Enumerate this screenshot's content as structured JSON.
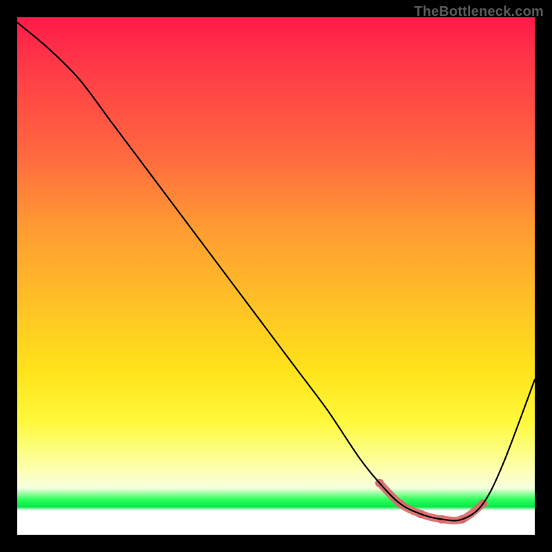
{
  "watermark": "TheBottleneck.com",
  "colors": {
    "accent": "#d96a6a",
    "curve": "#000000",
    "background": "#000000"
  },
  "chart_data": {
    "type": "line",
    "title": "",
    "xlabel": "",
    "ylabel": "",
    "xlim": [
      0,
      100
    ],
    "ylim": [
      0,
      100
    ],
    "grid": false,
    "legend": false,
    "series": [
      {
        "name": "bottleneck-curve",
        "x": [
          0,
          6,
          12,
          18,
          24,
          30,
          36,
          42,
          48,
          54,
          60,
          66,
          70,
          74,
          78,
          82,
          86,
          90,
          94,
          100
        ],
        "y": [
          99,
          94,
          88,
          80,
          72,
          64,
          56,
          48,
          40,
          32,
          24,
          15,
          10,
          6,
          4,
          3,
          3,
          6,
          14,
          30
        ]
      }
    ],
    "accent_region": {
      "name": "optimal-zone",
      "x": [
        70,
        74,
        78,
        82,
        86,
        90
      ],
      "y": [
        10,
        6,
        4,
        3,
        3,
        6
      ]
    },
    "gradient_stops": [
      {
        "pos": 0.0,
        "color": "#ff1a49"
      },
      {
        "pos": 0.27,
        "color": "#ff6a3f"
      },
      {
        "pos": 0.55,
        "color": "#ffc026"
      },
      {
        "pos": 0.78,
        "color": "#fff83a"
      },
      {
        "pos": 0.93,
        "color": "#2bff5a"
      },
      {
        "pos": 0.95,
        "color": "#ffffff"
      },
      {
        "pos": 1.0,
        "color": "#ffffff"
      }
    ]
  }
}
